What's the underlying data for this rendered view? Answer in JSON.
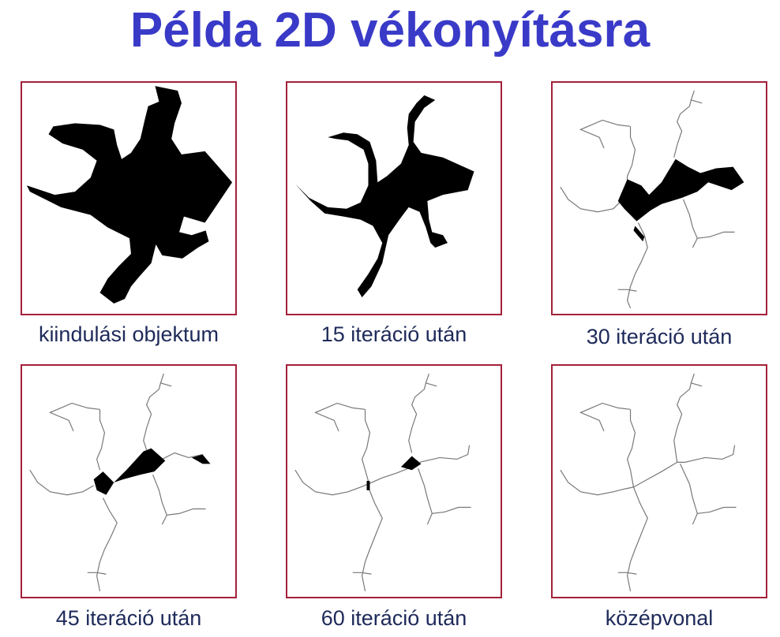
{
  "title": "Példa 2D vékonyításra",
  "colors": {
    "title": "#3a3ac8",
    "frame": "#a3203a",
    "caption": "#1e2a5a",
    "object": "#000000",
    "skeleton": "#777777"
  },
  "panels": [
    {
      "caption": "kiindulási objektum"
    },
    {
      "caption": "15 iteráció után"
    },
    {
      "caption": "30 iteráció után"
    },
    {
      "caption": "45 iteráció után"
    },
    {
      "caption": "60 iteráció után"
    },
    {
      "caption": "középvonal"
    }
  ]
}
